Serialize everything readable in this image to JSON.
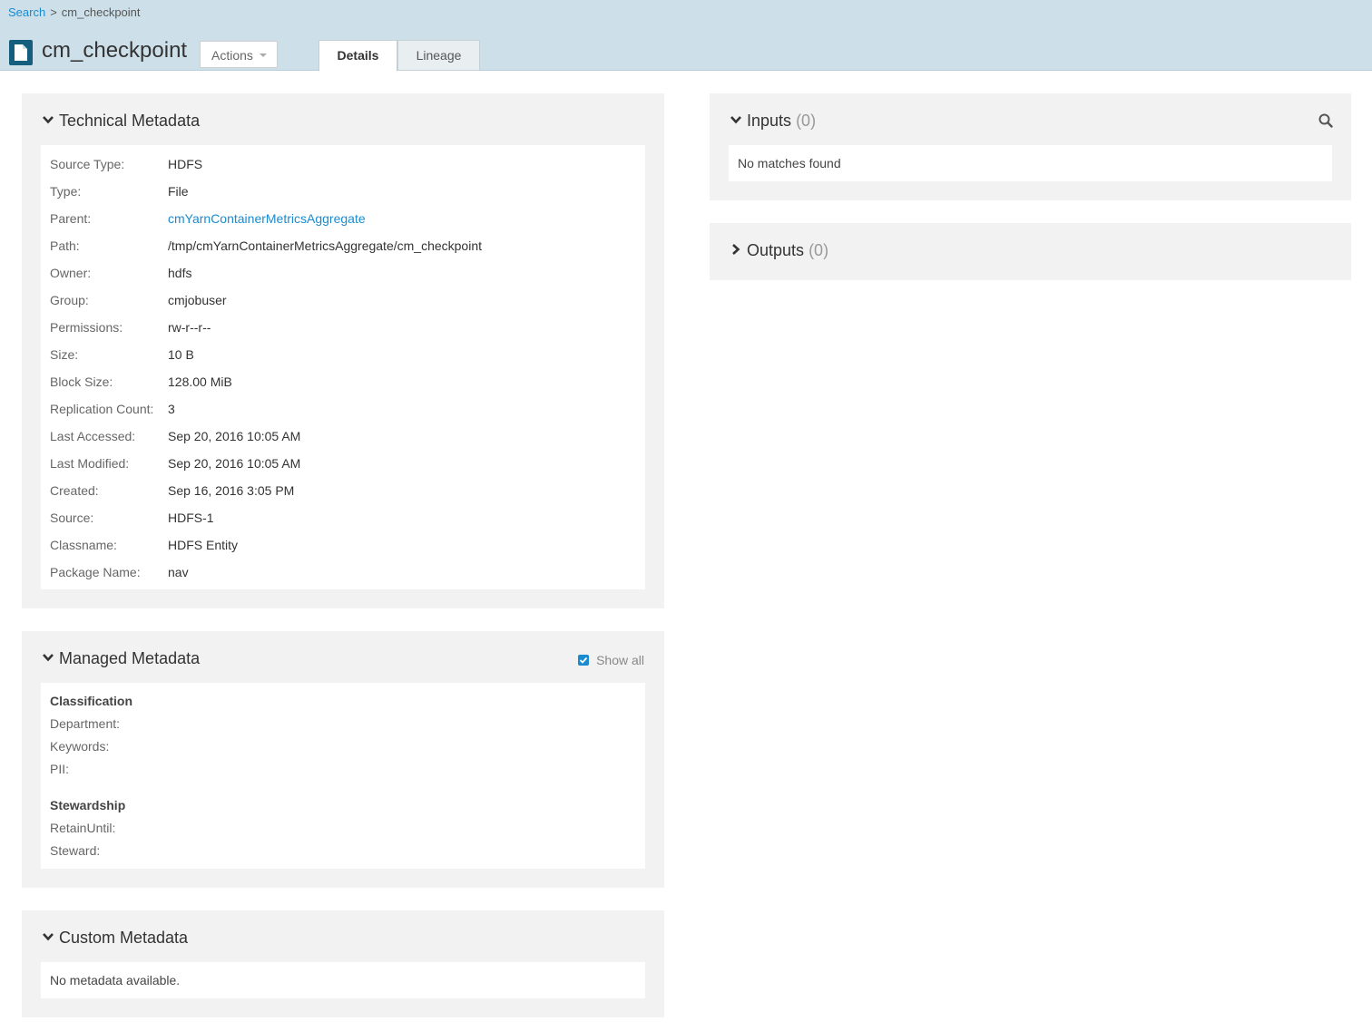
{
  "breadcrumb": {
    "search": "Search",
    "separator": ">",
    "current": "cm_checkpoint"
  },
  "header": {
    "title": "cm_checkpoint",
    "actions_label": "Actions",
    "tabs": [
      {
        "label": "Details",
        "active": true
      },
      {
        "label": "Lineage",
        "active": false
      }
    ]
  },
  "technical": {
    "title": "Technical Metadata",
    "rows": [
      {
        "label": "Source Type:",
        "value": "HDFS"
      },
      {
        "label": "Type:",
        "value": "File"
      },
      {
        "label": "Parent:",
        "value": "cmYarnContainerMetricsAggregate"
      },
      {
        "label": "Path:",
        "value": "/tmp/cmYarnContainerMetricsAggregate/cm_checkpoint"
      },
      {
        "label": "Owner:",
        "value": "hdfs"
      },
      {
        "label": "Group:",
        "value": "cmjobuser"
      },
      {
        "label": "Permissions:",
        "value": "rw-r--r--"
      },
      {
        "label": "Size:",
        "value": "10 B"
      },
      {
        "label": "Block Size:",
        "value": "128.00 MiB"
      },
      {
        "label": "Replication Count:",
        "value": "3"
      },
      {
        "label": "Last Accessed:",
        "value": "Sep 20, 2016 10:05 AM"
      },
      {
        "label": "Last Modified:",
        "value": "Sep 20, 2016 10:05 AM"
      },
      {
        "label": "Created:",
        "value": "Sep 16, 2016 3:05 PM"
      },
      {
        "label": "Source:",
        "value": "HDFS-1"
      },
      {
        "label": "Classname:",
        "value": "HDFS Entity"
      },
      {
        "label": "Package Name:",
        "value": "nav"
      }
    ]
  },
  "managed": {
    "title": "Managed Metadata",
    "show_all_label": "Show all",
    "show_all_checked": true,
    "sections": [
      {
        "name": "Classification",
        "fields": [
          "Department:",
          "Keywords:",
          "PII:"
        ]
      },
      {
        "name": "Stewardship",
        "fields": [
          "RetainUntil:",
          "Steward:"
        ]
      }
    ]
  },
  "custom": {
    "title": "Custom Metadata",
    "empty_text": "No metadata available."
  },
  "inputs": {
    "title": "Inputs",
    "count": "(0)",
    "empty_text": "No matches found"
  },
  "outputs": {
    "title": "Outputs",
    "count": "(0)"
  },
  "colors": {
    "header_bg": "#cde0ea",
    "link": "#1a8bd0",
    "panel_bg": "#f2f2f2",
    "icon_bg": "#155e7e"
  }
}
